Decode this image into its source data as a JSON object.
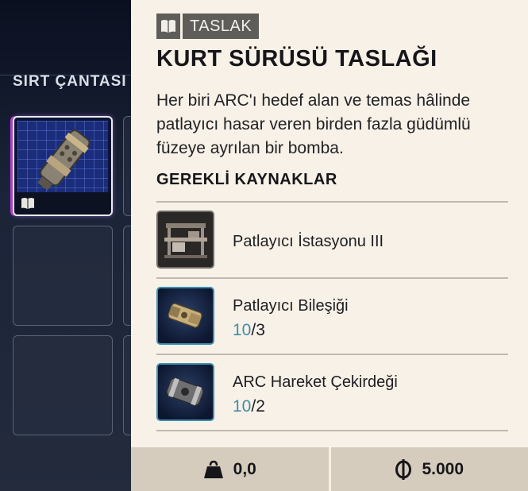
{
  "inventory": {
    "title": "SIRT ÇANTASI"
  },
  "tooltip": {
    "tag_label": "TASLAK",
    "title": "KURT SÜRÜSÜ TASLAĞI",
    "description": "Her biri ARC'ı hedef alan ve temas hâlinde patlayıcı hasar veren birden fazla güdümlü füzeye ayrılan bir bomba.",
    "requirements_header": "GEREKLİ KAYNAKLAR",
    "requirements": [
      {
        "name": "Patlayıcı İstasyonu III",
        "icon": "explosives-station-icon"
      },
      {
        "name": "Patlayıcı Bileşiği",
        "have": "10",
        "sep": "/",
        "need": "3",
        "icon": "explosive-compound-icon"
      },
      {
        "name": "ARC Hareket Çekirdeği",
        "have": "10",
        "sep": "/",
        "need": "2",
        "icon": "arc-motion-core-icon"
      }
    ],
    "footer": {
      "weight": "0,0",
      "price": "5.000"
    }
  },
  "colors": {
    "panel_bg": "#f7f1e7",
    "footer_bg": "#d6ccbd",
    "tag_bg": "#5e5d5a",
    "qty_have": "#3f8ea6",
    "selected_slot_border": "#e8ecf4",
    "slot_bg": "#1a2c7a"
  }
}
